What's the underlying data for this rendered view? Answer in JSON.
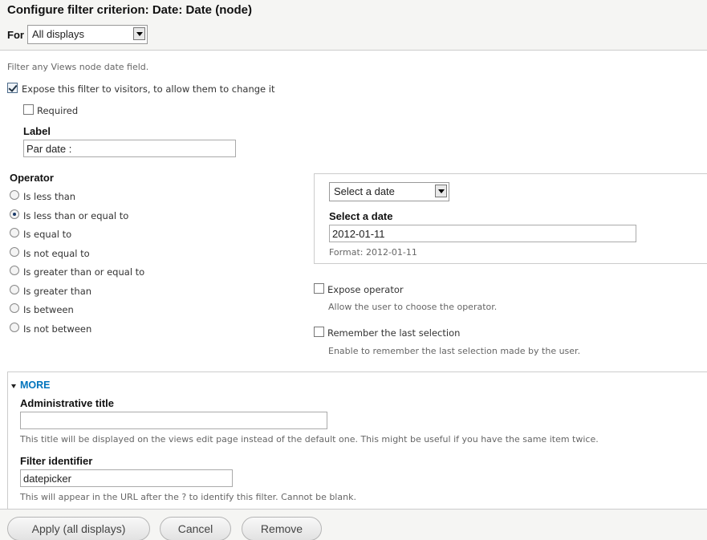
{
  "header": {
    "title": "Configure filter criterion: Date: Date (node)",
    "for_label": "For",
    "for_select": "All displays"
  },
  "intro": "Filter any Views node date field.",
  "expose": {
    "label": "Expose this filter to visitors, to allow them to change it",
    "checked": true
  },
  "required": {
    "label": "Required",
    "checked": false
  },
  "label_field": {
    "title": "Label",
    "value": "Par date :"
  },
  "operator": {
    "title": "Operator",
    "options": [
      "Is less than",
      "Is less than or equal to",
      "Is equal to",
      "Is not equal to",
      "Is greater than or equal to",
      "Is greater than",
      "Is between",
      "Is not between"
    ],
    "selected_index": 1
  },
  "date_panel": {
    "type_select": "Select a date",
    "field_title": "Select a date",
    "value": "2012-01-11",
    "format_hint": "Format: 2012-01-11"
  },
  "expose_operator": {
    "label": "Expose operator",
    "description": "Allow the user to choose the operator.",
    "checked": false
  },
  "remember": {
    "label": "Remember the last selection",
    "description": "Enable to remember the last selection made by the user.",
    "checked": false
  },
  "more": {
    "toggle_label": "MORE",
    "admin_title": {
      "title": "Administrative title",
      "value": "",
      "description": "This title will be displayed on the views edit page instead of the default one. This might be useful if you have the same item twice."
    },
    "filter_identifier": {
      "title": "Filter identifier",
      "value": "datepicker",
      "description": "This will appear in the URL after the ? to identify this filter. Cannot be blank."
    }
  },
  "footer": {
    "apply": "Apply (all displays)",
    "cancel": "Cancel",
    "remove": "Remove"
  },
  "colors": {
    "link": "#0074bd",
    "header_bg": "#f5f5f3",
    "border": "#cccccc"
  }
}
